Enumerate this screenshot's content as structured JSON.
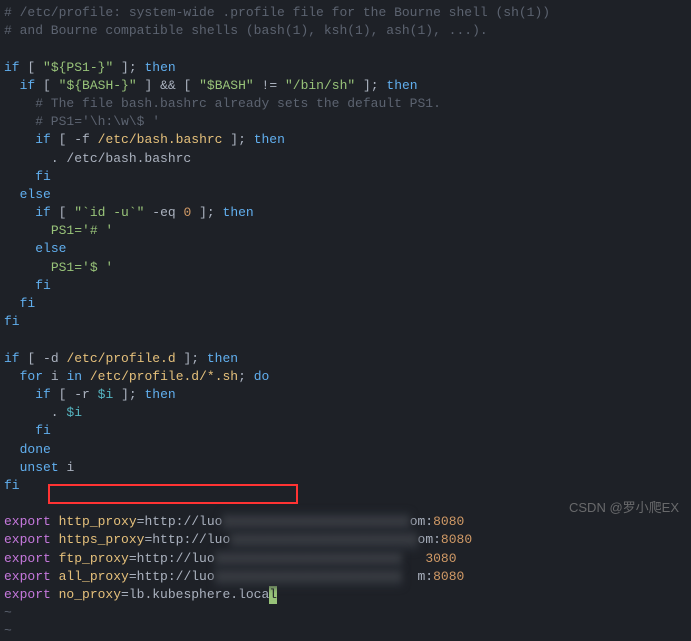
{
  "lines": {
    "l0": "# /etc/profile: system-wide .profile file for the Bourne shell (sh(1))",
    "l1": "# and Bourne compatible shells (bash(1), ksh(1), ash(1), ...).",
    "l2": "",
    "if_kw": "if",
    "then_kw": "then",
    "else_kw": "else",
    "fi_kw": "fi",
    "for_kw": "for",
    "in_kw": "in",
    "do_kw": "do",
    "done_kw": "done",
    "unset_kw": "unset",
    "export_kw": "export",
    "ps1_var": "${PS1-}",
    "bash_var": "${BASH-}",
    "bash_str": "$BASH",
    "binsh": "/bin/sh",
    "rc_comment": "    # The file bash.bashrc already sets the default PS1.",
    "ps1_comment": "    # PS1='\\h:\\w\\$ '",
    "bashrc_path": "/etc/bash.bashrc",
    "bashrc_dot": ". /etc/bash.bashrc",
    "id_cmd": "`id -u`",
    "eq_test": "-eq",
    "zero": "0",
    "ps1_root": "PS1='# '",
    "ps1_user": "PS1='$ '",
    "profiled": "/etc/profile.d",
    "profiled_glob": "/etc/profile.d/*.sh",
    "i_var": "i",
    "dot_i": ". $i",
    "dollar_i": "$i",
    "r_flag": "-r",
    "d_flag": "-d",
    "f_flag": "-f",
    "http_proxy": "http_proxy",
    "https_proxy": "https_proxy",
    "ftp_proxy": "ftp_proxy",
    "all_proxy": "all_proxy",
    "no_proxy": "no_proxy",
    "proxy_url": "=http://luo",
    "proxy_blur": "xxxxxxxxxxxxxxxxxxxxxxxx",
    "proxy_com": "om:",
    "port_8080": "8080",
    "port_3080": "3080",
    "no_proxy_val": "=lb.kubesphere.loca",
    "watermark": "CSDN @罗小爬EX",
    "tilde": "~"
  }
}
